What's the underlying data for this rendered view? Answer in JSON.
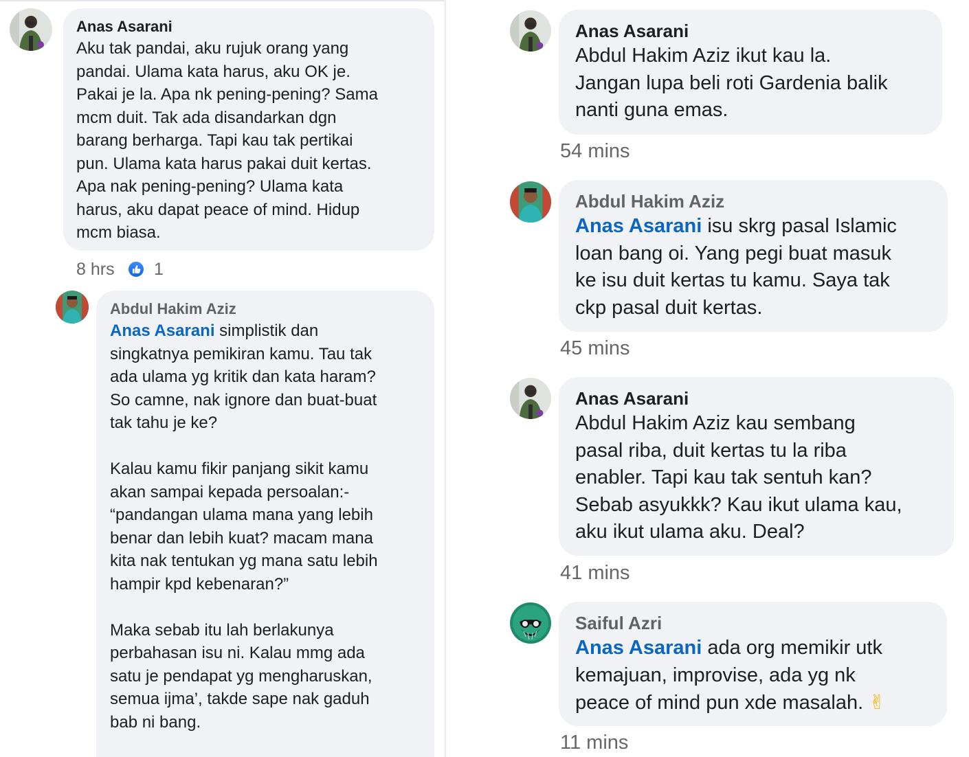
{
  "left": {
    "comment1": {
      "author": "Anas Asarani",
      "text": "Aku tak pandai, aku rujuk orang yang\npandai. Ulama kata harus, aku OK je.\nPakai je la. Apa nk pening-pening? Sama\nmcm duit. Tak ada disandarkan dgn\nbarang berharga. Tapi kau tak pertikai\npun. Ulama kata harus pakai duit kertas.\nApa nak pening-pening? Ulama kata\nharus, aku dapat peace of mind. Hidup\nmcm biasa.",
      "time": "8 hrs",
      "likes": "1"
    },
    "reply1": {
      "author": "Abdul Hakim Aziz",
      "mention": "Anas Asarani",
      "text": " simplistik dan\nsingkatnya pemikiran kamu. Tau tak\nada ulama yg kritik dan kata haram?\nSo camne, nak ignore dan buat-buat\ntak tahu je ke?\n\nKalau kamu fikir panjang sikit kamu\nakan sampai kepada persoalan:-\n“pandangan ulama mana yang lebih\nbenar dan lebih kuat? macam mana\nkita nak tentukan yg mana satu lebih\nhampir kpd kebenaran?”\n\nMaka sebab itu lah berlakunya\nperbahasan isu ni. Kalau mmg ada\nsatu je pendapat yg mengharuskan,\nsemua ijma’, takde sape nak gaduh\nbab ni bang."
    }
  },
  "right": {
    "c1": {
      "author": "Anas Asarani",
      "text": "Abdul Hakim Aziz ikut kau la.\nJangan lupa beli roti Gardenia balik\nnanti guna emas.",
      "time": "54 mins"
    },
    "c2": {
      "author": "Abdul Hakim Aziz",
      "mention": "Anas Asarani",
      "text": " isu skrg pasal Islamic\nloan bang oi. Yang pegi buat masuk\nke isu duit kertas tu kamu. Saya tak\nckp pasal duit kertas.",
      "time": "45 mins"
    },
    "c3": {
      "author": "Anas Asarani",
      "text": "Abdul Hakim Aziz kau sembang\npasal riba, duit kertas tu la riba\nenabler. Tapi kau tak sentuh kan?\nSebab asyukkk? Kau ikut ulama kau,\naku ikut ulama aku. Deal?",
      "time": "41 mins"
    },
    "c4": {
      "author": "Saiful Azri",
      "mention": "Anas Asarani",
      "text": " ada org memikir utk\nkemajuan, improvise, ada yg nk\npeace of mind pun xde masalah. ",
      "emoji": "✌",
      "time": "11 mins"
    }
  },
  "icons": {
    "avatar_anas": "avatar-photo-man-green-jacket",
    "avatar_hakim": "avatar-photo-man-teal-shirt",
    "avatar_saiful": "avatar-illustration-bearded-man",
    "like": "thumbs-up-icon"
  },
  "colors": {
    "bubble": "#f0f2f5",
    "mention": "#0a66c2",
    "like_badge": "#1877f2",
    "timestamp": "#65676b"
  }
}
